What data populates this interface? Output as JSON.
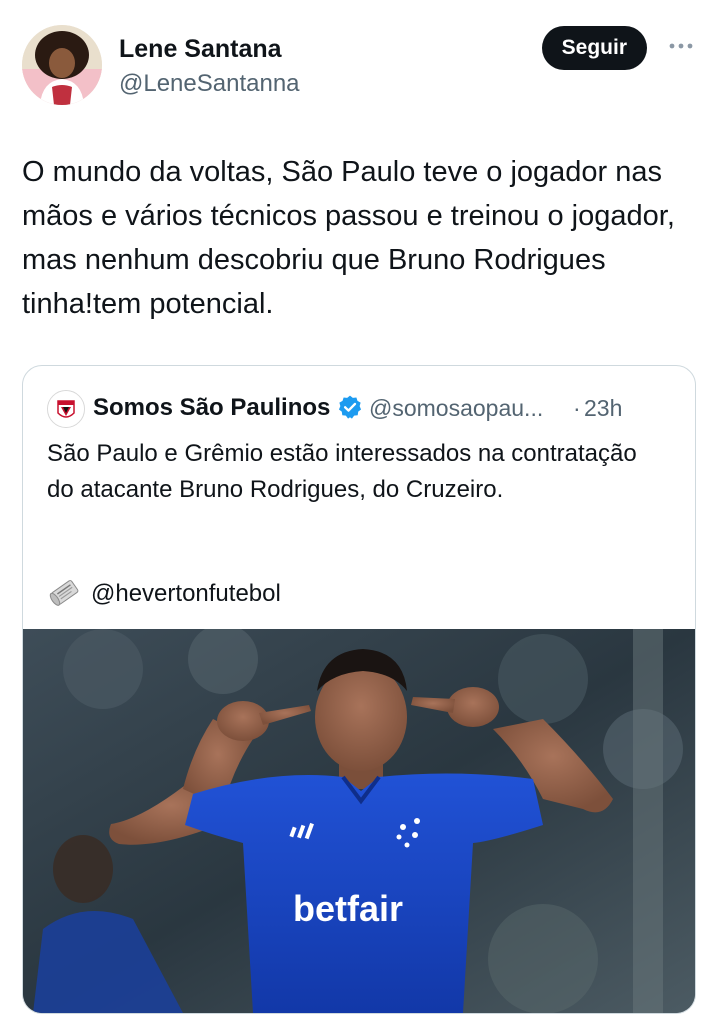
{
  "author": {
    "name": "Lene Santana",
    "handle": "@LeneSantanna"
  },
  "actions": {
    "follow_label": "Seguir",
    "more_icon": "more-horizontal-icon"
  },
  "tweet": {
    "text": "O mundo da voltas, São Paulo teve o jogador nas mãos e vários técnicos passou e treinou o jogador, mas nenhum descobriu que Bruno Rodrigues tinha!tem potencial."
  },
  "quoted": {
    "name": "Somos São Paulinos",
    "verified_icon": "verified-badge-icon",
    "handle": "@somosaopau...",
    "separator": "·",
    "time": "23h",
    "text": "São Paulo e Grêmio estão interessados na contratação do atacante Bruno Rodrigues, do Cruzeiro.",
    "credit_icon": "newspaper-icon",
    "credit": "@hevertonfutebol",
    "photo": {
      "sponsor": "betfair"
    }
  },
  "colors": {
    "text": "#0f1419",
    "secondary": "#536471",
    "border": "#cfd9de",
    "verified": "#1d9bf0",
    "jersey": "#1747c9"
  }
}
